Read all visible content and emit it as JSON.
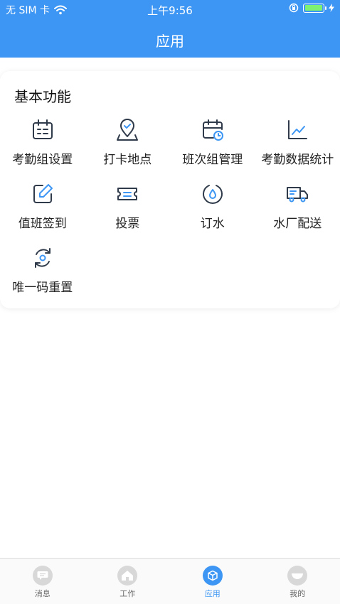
{
  "status_bar": {
    "carrier": "无 SIM 卡",
    "time": "上午9:56"
  },
  "header": {
    "title": "应用"
  },
  "section": {
    "title": "基本功能",
    "items": [
      {
        "label": "考勤组设置",
        "icon": "calendar-list-icon"
      },
      {
        "label": "打卡地点",
        "icon": "location-check-icon"
      },
      {
        "label": "班次组管理",
        "icon": "calendar-clock-icon"
      },
      {
        "label": "考勤数据统计",
        "icon": "line-chart-icon"
      },
      {
        "label": "值班签到",
        "icon": "edit-square-icon"
      },
      {
        "label": "投票",
        "icon": "ticket-icon"
      },
      {
        "label": "订水",
        "icon": "water-drop-icon"
      },
      {
        "label": "水厂配送",
        "icon": "delivery-truck-icon"
      },
      {
        "label": "唯一码重置",
        "icon": "refresh-cycle-icon"
      }
    ]
  },
  "tabbar": {
    "items": [
      {
        "label": "消息",
        "icon": "message-icon"
      },
      {
        "label": "工作",
        "icon": "home-icon"
      },
      {
        "label": "应用",
        "icon": "app-cube-icon",
        "active": true
      },
      {
        "label": "我的",
        "icon": "profile-icon"
      }
    ]
  },
  "colors": {
    "primary": "#3d96f3",
    "icon_stroke": "#2f3a4a"
  }
}
